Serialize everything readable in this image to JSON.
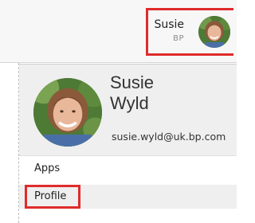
{
  "header": {
    "user_name": "Susie",
    "user_company": "BP",
    "avatar_icon": "user-avatar"
  },
  "profile": {
    "first_name": "Susie",
    "last_name": "Wyld",
    "email": "susie.wyld@uk.bp.com",
    "avatar_icon": "user-avatar"
  },
  "menu": {
    "items": [
      {
        "label": "Apps"
      },
      {
        "label": "Profile"
      }
    ]
  },
  "colors": {
    "highlight": "#e02b2b",
    "card_background": "#efefef",
    "header_background": "#f7f7f7"
  }
}
